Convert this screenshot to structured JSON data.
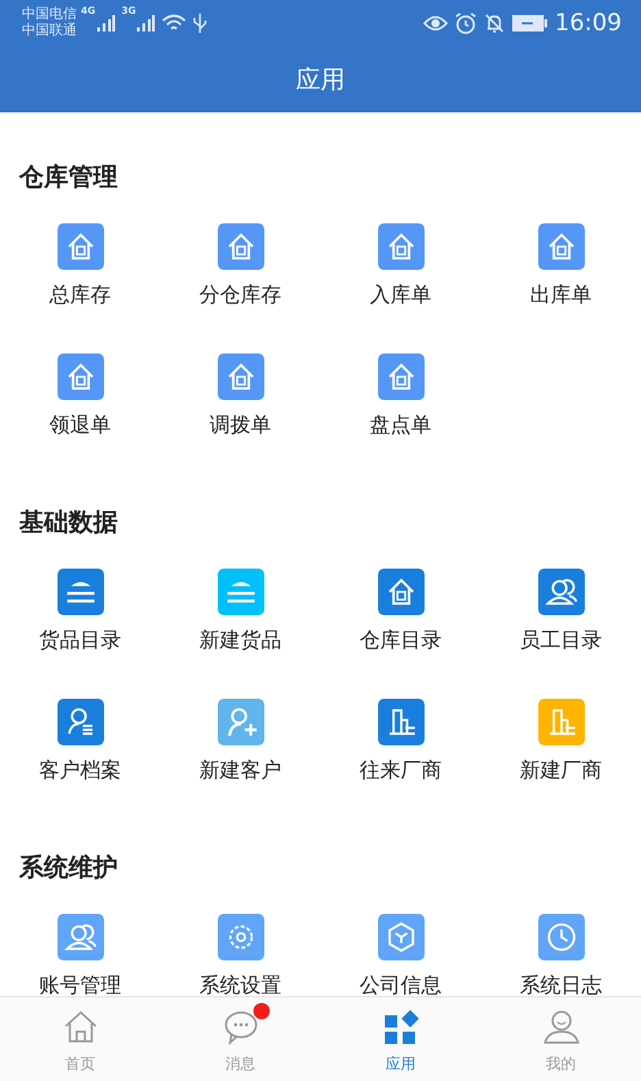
{
  "status_bar": {
    "carriers": [
      "中国电信",
      "中国联通"
    ],
    "network_tags": [
      "4G",
      "3G"
    ],
    "time": "16:09"
  },
  "header": {
    "title": "应用"
  },
  "sections": [
    {
      "title": "仓库管理",
      "items": [
        {
          "label": "总库存",
          "kind": "house",
          "color": "#5597f7"
        },
        {
          "label": "分仓库存",
          "kind": "house",
          "color": "#5597f7"
        },
        {
          "label": "入库单",
          "kind": "house",
          "color": "#5597f7"
        },
        {
          "label": "出库单",
          "kind": "house",
          "color": "#5597f7"
        },
        {
          "label": "领退单",
          "kind": "house",
          "color": "#5597f7"
        },
        {
          "label": "调拨单",
          "kind": "house",
          "color": "#5597f7"
        },
        {
          "label": "盘点单",
          "kind": "house",
          "color": "#5597f7"
        }
      ]
    },
    {
      "title": "基础数据",
      "items": [
        {
          "label": "货品目录",
          "kind": "layers",
          "color": "#1a7fdc"
        },
        {
          "label": "新建货品",
          "kind": "layers",
          "color": "#00c0fc"
        },
        {
          "label": "仓库目录",
          "kind": "house",
          "color": "#1a7fdc"
        },
        {
          "label": "员工目录",
          "kind": "people",
          "color": "#1a7fdc"
        },
        {
          "label": "客户档案",
          "kind": "person",
          "color": "#1a7fdc"
        },
        {
          "label": "新建客户",
          "kind": "person-add",
          "color": "#62b4ec"
        },
        {
          "label": "往来厂商",
          "kind": "building",
          "color": "#1a7fdc"
        },
        {
          "label": "新建厂商",
          "kind": "building",
          "color": "#ffb400"
        }
      ]
    },
    {
      "title": "系统维护",
      "items": [
        {
          "label": "账号管理",
          "kind": "people",
          "color": "#60a5f7"
        },
        {
          "label": "系统设置",
          "kind": "gear",
          "color": "#60a5f7"
        },
        {
          "label": "公司信息",
          "kind": "cube",
          "color": "#60a5f7"
        },
        {
          "label": "系统日志",
          "kind": "clock",
          "color": "#60a5f7"
        }
      ]
    }
  ],
  "tab_bar": [
    {
      "label": "首页",
      "kind": "home",
      "selected": false,
      "unread": false
    },
    {
      "label": "消息",
      "kind": "chat",
      "selected": false,
      "unread": true
    },
    {
      "label": "应用",
      "kind": "apps",
      "selected": true,
      "unread": false
    },
    {
      "label": "我的",
      "kind": "user",
      "selected": false,
      "unread": false
    }
  ]
}
